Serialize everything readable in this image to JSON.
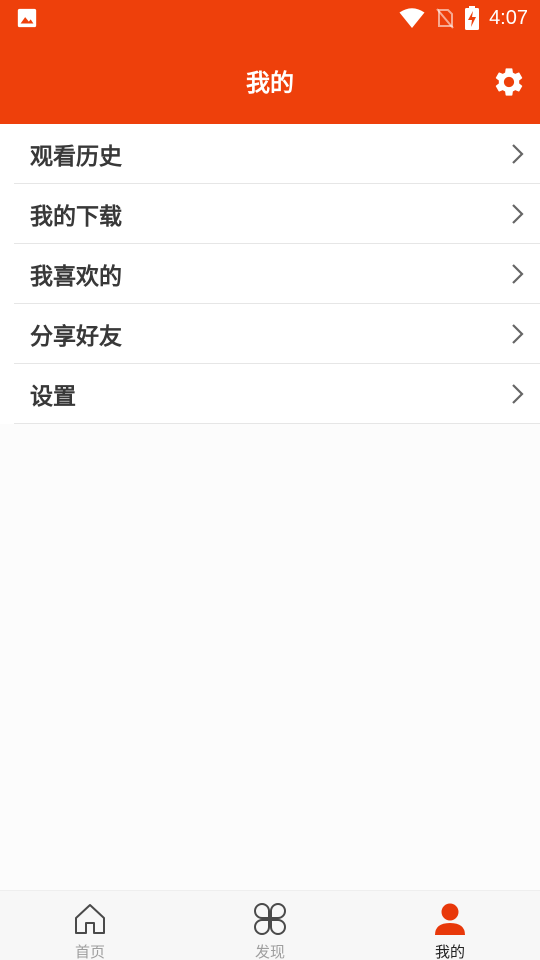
{
  "status_bar": {
    "time": "4:07",
    "icons": [
      "image-icon",
      "wifi-icon",
      "no-sim-icon",
      "battery-charging-icon"
    ]
  },
  "app_bar": {
    "title": "我的",
    "settings_icon": "gear-icon"
  },
  "menu": {
    "items": [
      {
        "label": "观看历史",
        "icon": "chevron-right-icon"
      },
      {
        "label": "我的下载",
        "icon": "chevron-right-icon"
      },
      {
        "label": "我喜欢的",
        "icon": "chevron-right-icon"
      },
      {
        "label": "分享好友",
        "icon": "chevron-right-icon"
      },
      {
        "label": "设置",
        "icon": "chevron-right-icon"
      }
    ]
  },
  "bottom_nav": {
    "items": [
      {
        "label": "首页",
        "icon": "home-icon",
        "active": false
      },
      {
        "label": "发现",
        "icon": "discover-icon",
        "active": false
      },
      {
        "label": "我的",
        "icon": "person-icon",
        "active": true
      }
    ]
  },
  "colors": {
    "brand": "#ee400b",
    "active_icon": "#e8380a",
    "inactive_text": "#9e9e9e",
    "active_text": "#222222"
  }
}
